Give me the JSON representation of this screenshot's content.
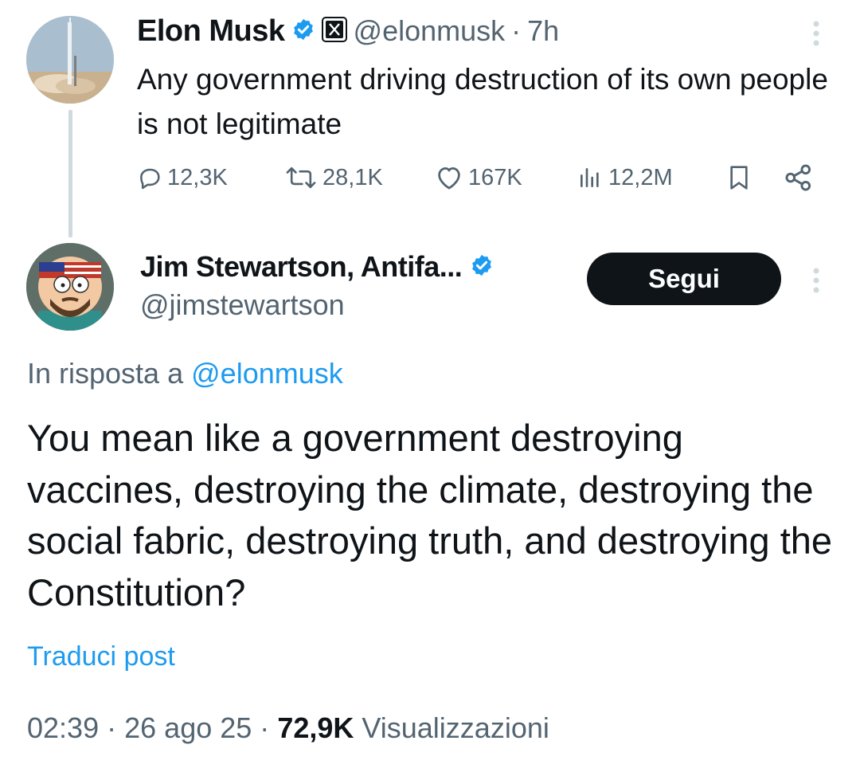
{
  "parent_post": {
    "author_name": "Elon Musk",
    "handle": "@elonmusk",
    "separator": "·",
    "time": "7h",
    "text": "Any government driving destruction of its own people is not legitimate",
    "stats": {
      "replies": "12,3K",
      "reposts": "28,1K",
      "likes": "167K",
      "views": "12,2M"
    }
  },
  "reply_post": {
    "author_name": "Jim Stewartson, Antifa...",
    "handle": "@jimstewartson",
    "follow_label": "Segui",
    "reply_prefix": "In risposta a",
    "reply_to_handle": "@elonmusk",
    "text": "You mean like a government destroying vaccines, destroying the climate, destroying the social fabric, destroying truth, and destroying the Constitution?",
    "translate_label": "Traduci post",
    "time": "02:39",
    "date": "26 ago 25",
    "views_count": "72,9K",
    "views_label": "Visualizzazioni",
    "separator": "·"
  },
  "colors": {
    "link_blue": "#1d9bf0",
    "verified_blue": "#1d9bf0",
    "muted_gray": "#536471",
    "text_black": "#0f1419",
    "button_bg": "#0f1419"
  },
  "icons": [
    "verified-badge-icon",
    "x-affiliate-icon",
    "more-vertical-icon",
    "reply-icon",
    "repost-icon",
    "like-icon",
    "views-icon",
    "bookmark-icon",
    "share-icon"
  ]
}
